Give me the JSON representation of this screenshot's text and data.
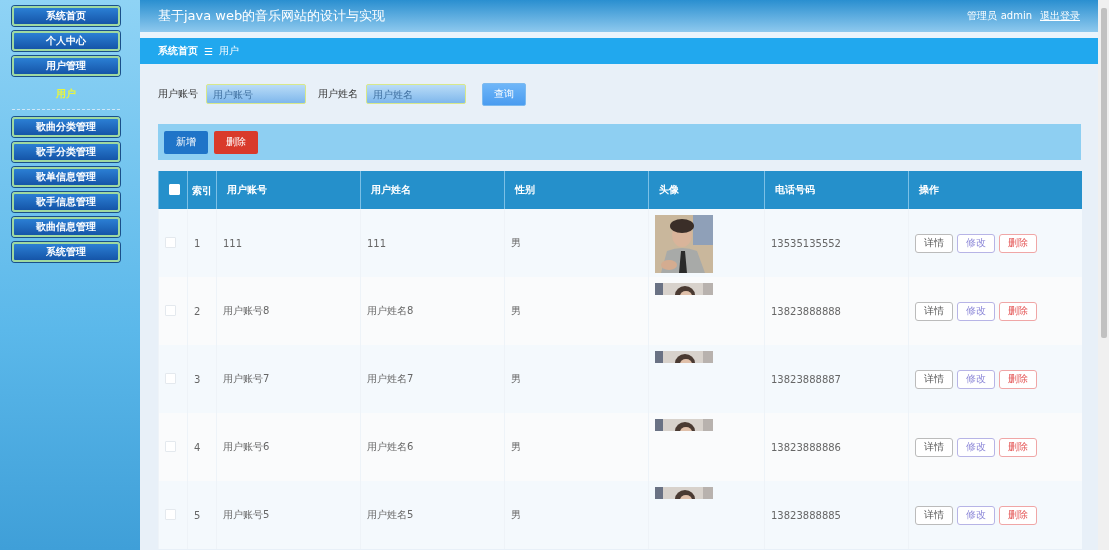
{
  "sidebar": {
    "items": [
      {
        "label": "系统首页",
        "kind": "button",
        "selected": false
      },
      {
        "label": "个人中心",
        "kind": "button",
        "selected": false
      },
      {
        "label": "用户管理",
        "kind": "button",
        "selected": false
      },
      {
        "label": "用户",
        "kind": "sub",
        "selected": true
      },
      {
        "label": "歌曲分类管理",
        "kind": "button",
        "selected": false
      },
      {
        "label": "歌手分类管理",
        "kind": "button",
        "selected": false
      },
      {
        "label": "歌单信息管理",
        "kind": "button",
        "selected": false
      },
      {
        "label": "歌手信息管理",
        "kind": "button",
        "selected": false
      },
      {
        "label": "歌曲信息管理",
        "kind": "button",
        "selected": false
      },
      {
        "label": "系统管理",
        "kind": "button",
        "selected": false
      }
    ]
  },
  "header": {
    "title": "基于java web的音乐网站的设计与实现",
    "user": "管理员 admin",
    "logout": "退出登录"
  },
  "breadcrumb": {
    "home": "系统首页",
    "separator": "☰",
    "current": "用户"
  },
  "search": {
    "fields": [
      {
        "label": "用户账号",
        "placeholder": "用户账号"
      },
      {
        "label": "用户姓名",
        "placeholder": "用户姓名"
      }
    ],
    "button": "查询"
  },
  "toolbar": {
    "buttons": [
      {
        "label": "新增",
        "kind": "add"
      },
      {
        "label": "删除",
        "kind": "delete"
      }
    ]
  },
  "table": {
    "select_all": {
      "checked": false
    },
    "columns": [
      "索引",
      "用户账号",
      "用户姓名",
      "性别",
      "头像",
      "电话号码",
      "操作"
    ],
    "rows": [
      {
        "checked": false,
        "index": "1",
        "account": "111",
        "name": "111",
        "gender": "男",
        "phone": "13535135552",
        "actions": [
          {
            "label": "详情",
            "kind": "detail"
          },
          {
            "label": "修改",
            "kind": "edit"
          },
          {
            "label": "删除",
            "kind": "delete"
          }
        ]
      },
      {
        "checked": false,
        "index": "2",
        "account": "用户账号8",
        "name": "用户姓名8",
        "gender": "男",
        "avatar": {
          "kind": "partial-picture"
        },
        "phone": "13823888888",
        "actions": [
          {
            "label": "详情",
            "kind": "detail"
          },
          {
            "label": "修改",
            "kind": "edit"
          },
          {
            "label": "删除",
            "kind": "delete"
          }
        ]
      },
      {
        "checked": false,
        "index": "3",
        "account": "用户账号7",
        "name": "用户姓名7",
        "gender": "男",
        "avatar": {
          "kind": "partial-picture"
        },
        "phone": "13823888887",
        "actions": [
          {
            "label": "详情",
            "kind": "detail"
          },
          {
            "label": "修改",
            "kind": "edit"
          },
          {
            "label": "删除",
            "kind": "delete"
          }
        ]
      },
      {
        "checked": false,
        "index": "4",
        "account": "用户账号6",
        "name": "用户姓名6",
        "gender": "男",
        "avatar": {
          "kind": "partial-picture"
        },
        "phone": "13823888886",
        "actions": [
          {
            "label": "详情",
            "kind": "detail"
          },
          {
            "label": "修改",
            "kind": "edit"
          },
          {
            "label": "删除",
            "kind": "delete"
          }
        ]
      },
      {
        "checked": false,
        "index": "5",
        "account": "用户账号5",
        "name": "用户姓名5",
        "gender": "男",
        "avatar": {
          "kind": "partial-picture"
        },
        "phone": "13823888885",
        "actions": [
          {
            "label": "详情",
            "kind": "detail"
          },
          {
            "label": "修改",
            "kind": "edit"
          },
          {
            "label": "删除",
            "kind": "delete"
          }
        ]
      }
    ]
  }
}
